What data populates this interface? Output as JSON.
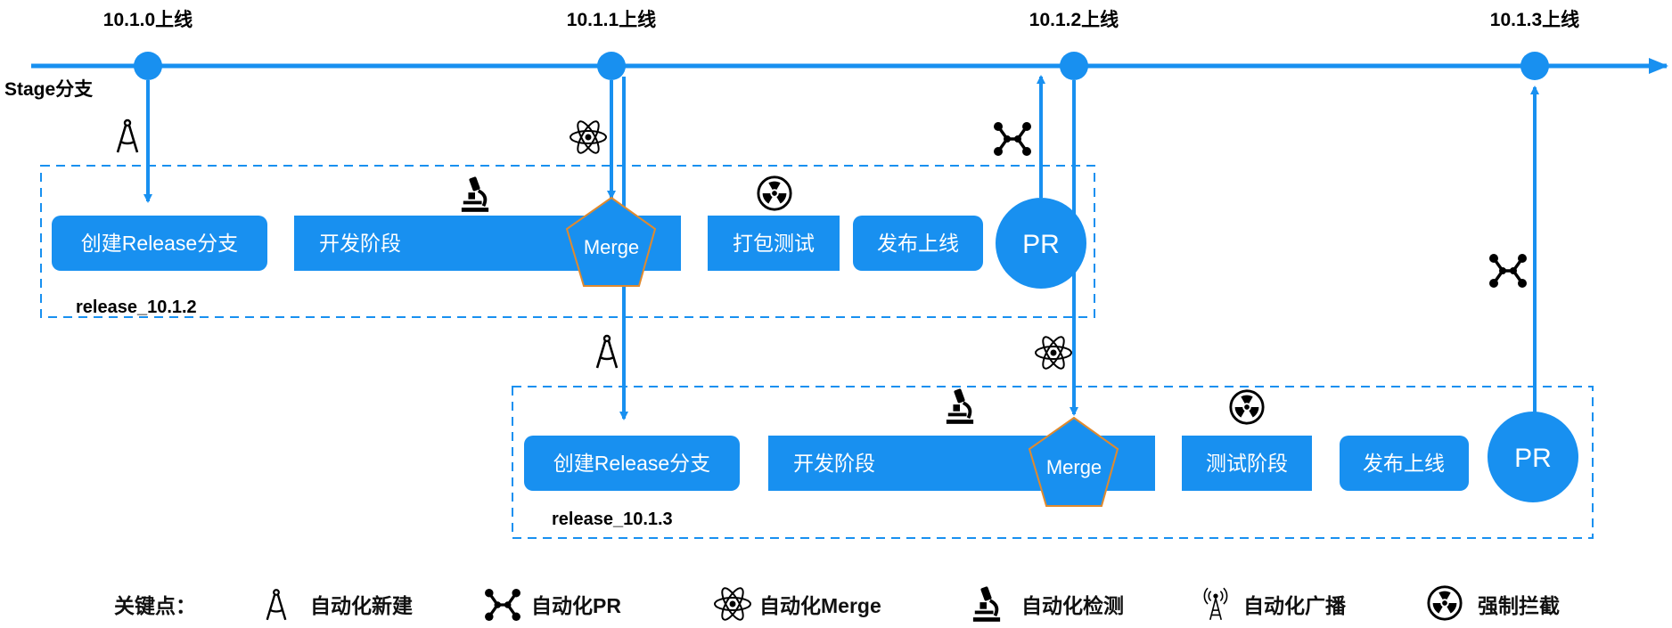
{
  "timeline": {
    "label": "Stage分支",
    "releases": [
      "10.1.0上线",
      "10.1.1上线",
      "10.1.2上线",
      "10.1.3上线"
    ]
  },
  "branch1": {
    "name": "release_10.1.2",
    "create": "创建Release分支",
    "dev": "开发阶段",
    "merge": "Merge",
    "package": "打包测试",
    "publish": "发布上线",
    "pr": "PR"
  },
  "branch2": {
    "name": "release_10.1.3",
    "create": "创建Release分支",
    "dev": "开发阶段",
    "merge": "Merge",
    "test": "测试阶段",
    "publish": "发布上线",
    "pr": "PR"
  },
  "legend": {
    "title": "关键点：",
    "items": [
      {
        "icon": "compass-icon",
        "label": "自动化新建"
      },
      {
        "icon": "pr-network-icon",
        "label": "自动化PR"
      },
      {
        "icon": "atom-icon",
        "label": "自动化Merge"
      },
      {
        "icon": "microscope-icon",
        "label": "自动化检测"
      },
      {
        "icon": "broadcast-icon",
        "label": "自动化广播"
      },
      {
        "icon": "radiation-icon",
        "label": "强制拦截"
      }
    ]
  },
  "colors": {
    "blue": "#1890f0",
    "merge_border": "#e08a2e",
    "dash": "#1890f0"
  }
}
